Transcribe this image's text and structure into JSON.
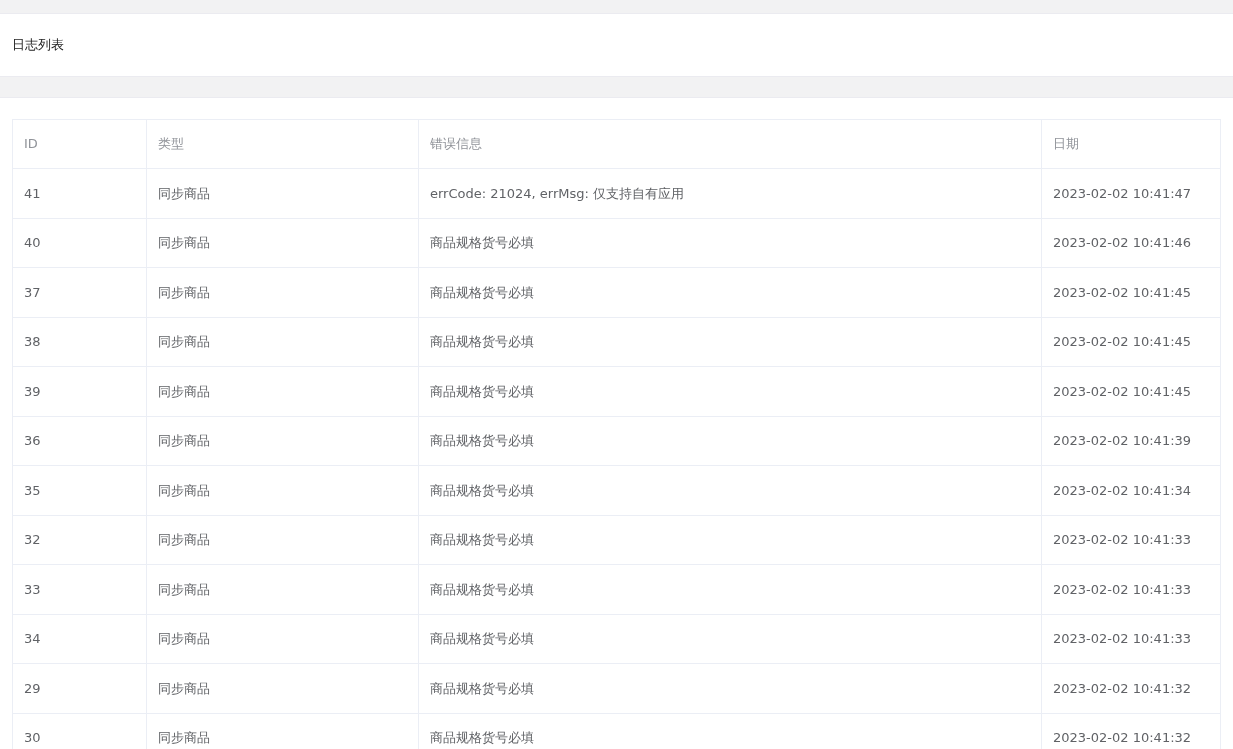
{
  "page_title": "日志列表",
  "table": {
    "columns": [
      "ID",
      "类型",
      "错误信息",
      "日期"
    ],
    "rows": [
      [
        "41",
        "同步商品",
        "errCode: 21024, errMsg: 仅支持自有应用",
        "2023-02-02 10:41:47"
      ],
      [
        "40",
        "同步商品",
        "商品规格货号必填",
        "2023-02-02 10:41:46"
      ],
      [
        "37",
        "同步商品",
        "商品规格货号必填",
        "2023-02-02 10:41:45"
      ],
      [
        "38",
        "同步商品",
        "商品规格货号必填",
        "2023-02-02 10:41:45"
      ],
      [
        "39",
        "同步商品",
        "商品规格货号必填",
        "2023-02-02 10:41:45"
      ],
      [
        "36",
        "同步商品",
        "商品规格货号必填",
        "2023-02-02 10:41:39"
      ],
      [
        "35",
        "同步商品",
        "商品规格货号必填",
        "2023-02-02 10:41:34"
      ],
      [
        "32",
        "同步商品",
        "商品规格货号必填",
        "2023-02-02 10:41:33"
      ],
      [
        "33",
        "同步商品",
        "商品规格货号必填",
        "2023-02-02 10:41:33"
      ],
      [
        "34",
        "同步商品",
        "商品规格货号必填",
        "2023-02-02 10:41:33"
      ],
      [
        "29",
        "同步商品",
        "商品规格货号必填",
        "2023-02-02 10:41:32"
      ],
      [
        "30",
        "同步商品",
        "商品规格货号必填",
        "2023-02-02 10:41:32"
      ]
    ]
  }
}
